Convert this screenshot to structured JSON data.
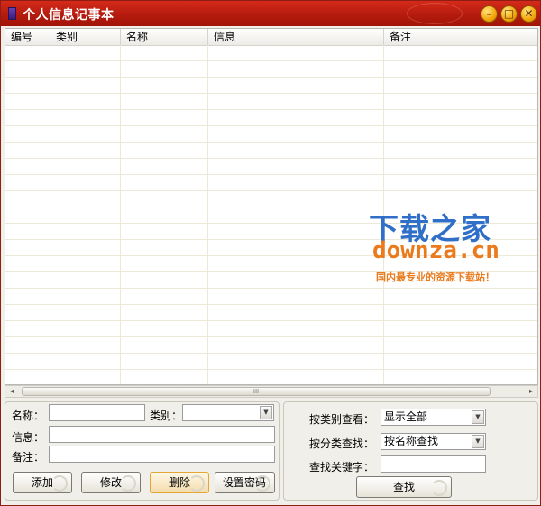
{
  "window": {
    "title": "个人信息记事本",
    "controls": {
      "minimize": "–",
      "maximize": "□",
      "close": "✕"
    }
  },
  "table": {
    "columns": [
      "编号",
      "类别",
      "名称",
      "信息",
      "备注"
    ],
    "rows": []
  },
  "watermark": {
    "title": "下载之家",
    "domain": "downza.cn",
    "slogan": "国内最专业的资源下载站！"
  },
  "scrollbar": {
    "thumb_grip": "III",
    "left_arrow": "◂",
    "right_arrow": "▸"
  },
  "form": {
    "name_label": "名称：",
    "category_label": "类别：",
    "info_label": "信息：",
    "note_label": "备注：",
    "name_value": "",
    "category_value": "",
    "info_value": "",
    "note_value": ""
  },
  "buttons": {
    "add": "添加",
    "edit": "修改",
    "delete": "删除",
    "set_password": "设置密码",
    "search": "查找"
  },
  "filter": {
    "view_by_category_label": "按类别查看：",
    "view_by_category_value": "显示全部",
    "search_by_field_label": "按分类查找：",
    "search_by_field_value": "按名称查找",
    "keyword_label": "查找关键字：",
    "keyword_value": ""
  },
  "colors": {
    "titlebar": "#b51b0e",
    "watermark_blue": "#2f6fc8",
    "watermark_orange": "#ea7a1c",
    "active_button_border": "#e6a633"
  },
  "icons": [
    "app-icon",
    "minimize-icon",
    "maximize-icon",
    "close-icon",
    "dropdown-arrow-icon",
    "scroll-left-icon",
    "scroll-right-icon"
  ]
}
